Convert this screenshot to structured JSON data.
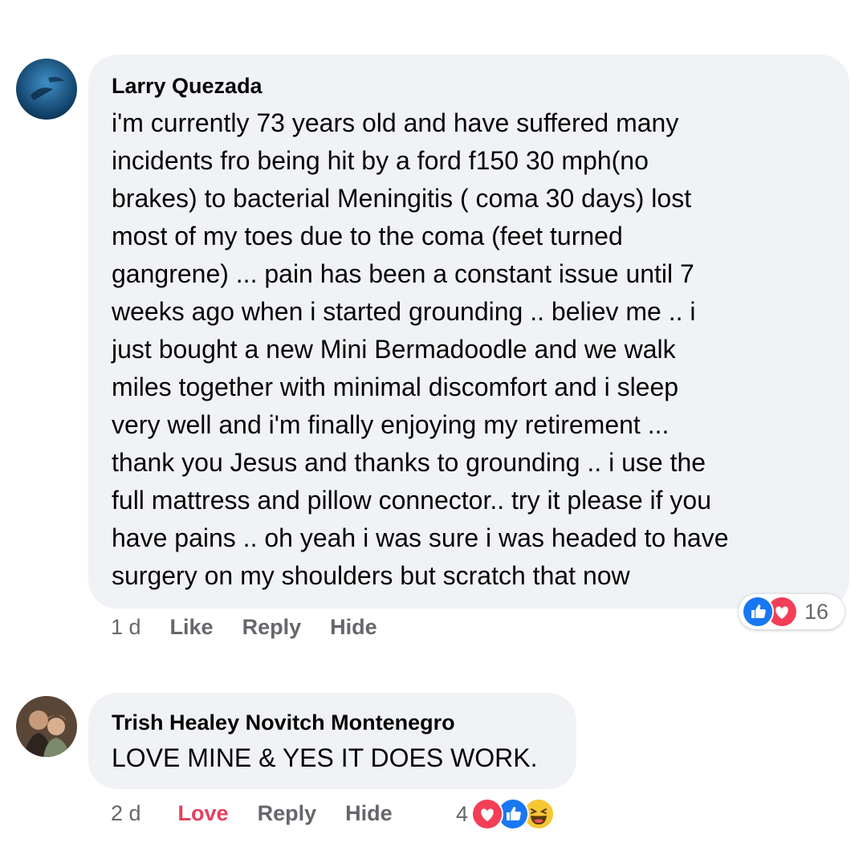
{
  "comments": [
    {
      "author": "Larry Quezada",
      "lines": [
        "i'm currently 73 years old and have suffered many",
        "incidents fro being hit by a ford f150 30 mph(no",
        "brakes) to bacterial Meningitis ( coma 30 days) lost",
        "most of my toes due to the coma (feet turned",
        "gangrene) ... pain has been a constant issue until 7",
        "weeks ago when i started grounding .. believ me .. i",
        "just bought a new Mini Bermadoodle and we walk",
        "miles together with minimal discomfort and i sleep",
        "very well and i'm finally enjoying my retirement ...",
        "thank you Jesus and thanks to grounding .. i use the",
        "full mattress and pillow connector.. try it please if you",
        "have pains .. oh yeah i was sure i was headed to have",
        "surgery on my shoulders but scratch that now"
      ],
      "time": "1 d",
      "like_label": "Like",
      "reply_label": "Reply",
      "hide_label": "Hide",
      "reaction_count": "16",
      "reactions": [
        "like-icon",
        "love-icon"
      ]
    },
    {
      "author": "Trish Healey Novitch Montenegro",
      "lines": [
        "LOVE MINE & YES IT DOES WORK."
      ],
      "time": "2 d",
      "like_label": "Love",
      "reply_label": "Reply",
      "hide_label": "Hide",
      "reaction_count": "4",
      "reactions": [
        "love-icon",
        "like-icon",
        "haha-icon"
      ]
    }
  ],
  "colors": {
    "bubble": "#f0f2f5",
    "meta": "#65676b",
    "love": "#e4405f",
    "like_blue": "#1877f2"
  }
}
